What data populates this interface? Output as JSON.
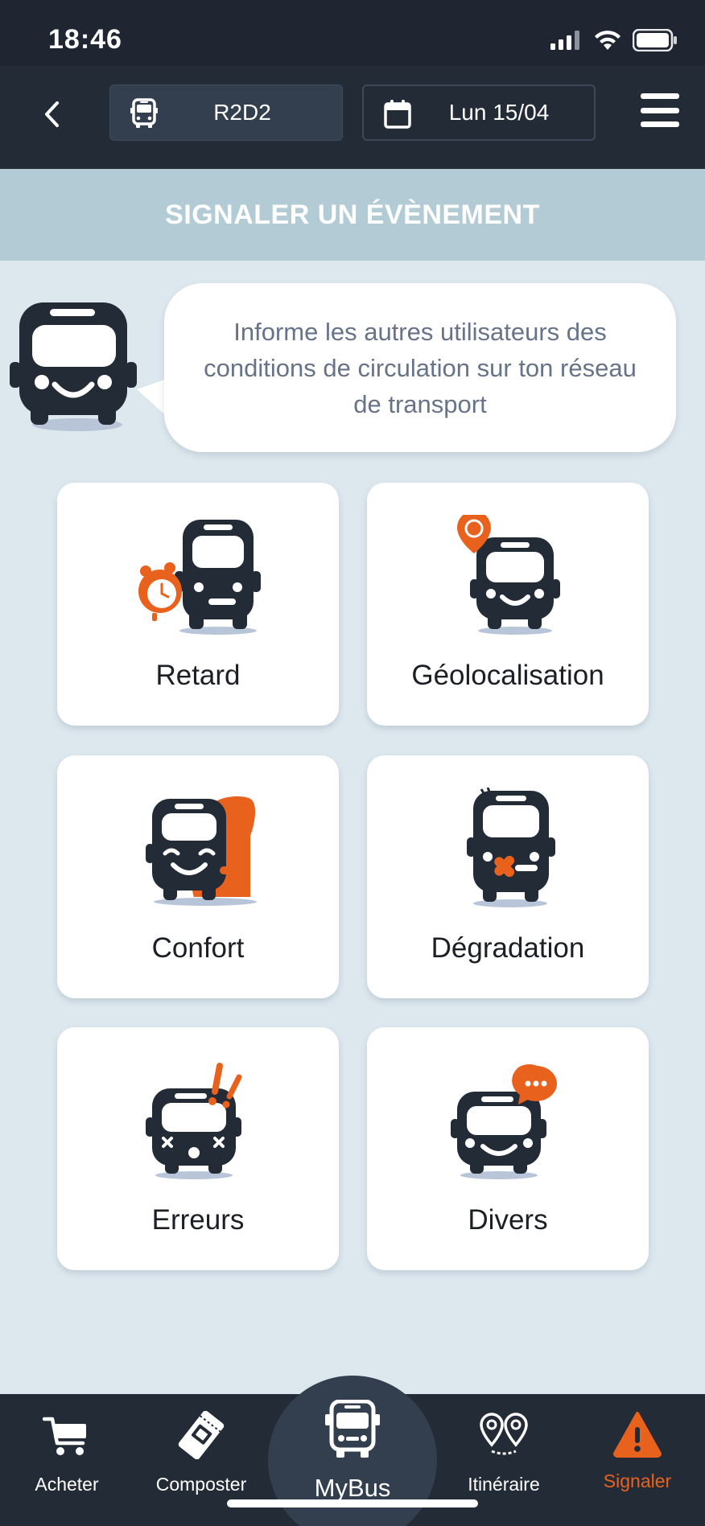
{
  "status_bar": {
    "time": "18:46"
  },
  "header": {
    "line_label": "R2D2",
    "date_label": "Lun 15/04"
  },
  "banner": {
    "title": "SIGNALER UN ÉVÈNEMENT"
  },
  "intro": {
    "text": "Informe les autres utilisateurs des conditions de circulation sur ton réseau de transport"
  },
  "cards": [
    {
      "label": "Retard",
      "icon": "bus-clock-icon"
    },
    {
      "label": "Géolocalisation",
      "icon": "bus-location-pin-icon"
    },
    {
      "label": "Confort",
      "icon": "bus-armchair-icon"
    },
    {
      "label": "Dégradation",
      "icon": "bus-bandage-icon"
    },
    {
      "label": "Erreurs",
      "icon": "bus-error-icon"
    },
    {
      "label": "Divers",
      "icon": "bus-chat-bubble-icon"
    }
  ],
  "bottom_nav": {
    "items": [
      {
        "label": "Acheter",
        "icon": "cart-icon"
      },
      {
        "label": "Composter",
        "icon": "ticket-icon"
      },
      {
        "label": "MyBus",
        "icon": "bus-icon"
      },
      {
        "label": "Itinéraire",
        "icon": "route-pins-icon"
      },
      {
        "label": "Signaler",
        "icon": "warning-icon",
        "active": true
      }
    ]
  },
  "colors": {
    "dark": "#232b37",
    "accent": "#e9621d",
    "banner": "#b2cbd5",
    "background": "#dde7ee",
    "text_muted": "#677389"
  }
}
